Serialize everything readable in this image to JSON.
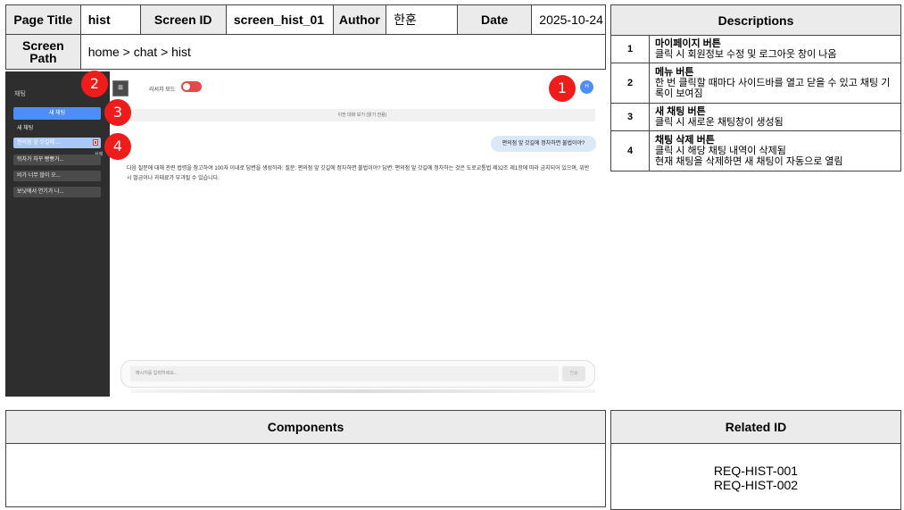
{
  "header": {
    "page_title_label": "Page Title",
    "page_title_value": "hist",
    "screen_id_label": "Screen ID",
    "screen_id_value": "screen_hist_01",
    "author_label": "Author",
    "author_value": "한훈",
    "date_label": "Date",
    "date_value": "2025-10-24",
    "screen_path_label": "Screen Path",
    "screen_path_value": "home >  chat > hist"
  },
  "descriptions": {
    "title": "Descriptions",
    "items": [
      {
        "num": "1",
        "title": "마이페이지 버튼",
        "text": "클릭 시 회원정보 수정 및 로그아웃 창이 나옴"
      },
      {
        "num": "2",
        "title": "메뉴 버튼",
        "text": "한 번 클릭할 때마다 사이드바를 열고 닫을 수 있고 채팅 기록이 보여짐"
      },
      {
        "num": "3",
        "title": "새 채팅 버튼",
        "text": "클릭 시 새로운 채팅창이 생성됨"
      },
      {
        "num": "4",
        "title": "채팅 삭제 버튼",
        "text": "클릭 시 해당 채팅 내역이 삭제됨\n현재 채팅을 삭제하면 새 채팅이 자동으로 열림"
      }
    ]
  },
  "components": {
    "title": "Components"
  },
  "related": {
    "title": "Related ID",
    "ids": [
      "REQ-HIST-001",
      "REQ-HIST-002"
    ]
  },
  "screen": {
    "sidebar_title": "채팅",
    "new_chat_label": "새 채팅",
    "history": [
      "새 채팅",
      "편의점 앞 갓길에 ...",
      "뒤차가 자꾸 빵빵거...",
      "비가 너무 많이 오...",
      "보닛에서 연기가 나..."
    ],
    "delete_tooltip": "삭제",
    "menu_glyph": "≡",
    "research_mode_label": "리서치 모드",
    "avatar_letter": "H",
    "prev_chat_bar": "이전 대화 보기 (읽기 전용)",
    "user_message": "편의점 앞 갓길에 정차하면 불법이야?",
    "assistant_answer": "다음 질문에 대해 관련 법령을 참고하여 100자 이내로 답변을 생성하라: 질문: 편의점 앞 갓길에 정차하면 불법이야? 답변: 편의점 앞 갓길에 정차하는 것은 도로교통법 제32조 제1항에 따라 금지되어 있으며, 위반 시 벌금이나 과태료가 부과될 수 있습니다.",
    "input_placeholder": "메시지를 입력하세요...",
    "send_label": "전송"
  },
  "markers": [
    "1",
    "2",
    "3",
    "4"
  ],
  "colors": {
    "marker": "#ef1c1c",
    "accent": "#4e8cf7",
    "toggle": "#e74848",
    "sidebar": "#2e2e2e"
  }
}
